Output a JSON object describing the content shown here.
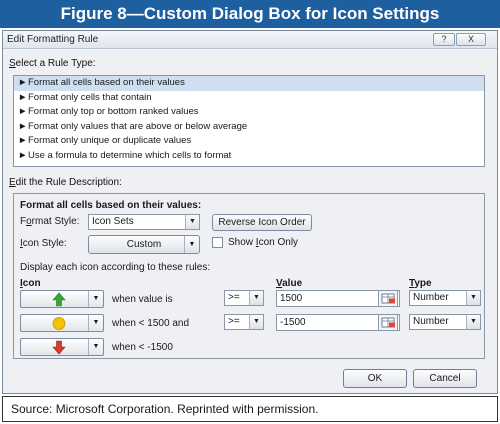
{
  "figure_title": "Figure 8—Custom Dialog Box for Icon Settings",
  "window": {
    "title": "Edit Formatting Rule",
    "help_label": "?",
    "close_label": "X"
  },
  "rule_type": {
    "label_prefix": "",
    "label_u": "S",
    "label_rest": "elect a Rule Type:",
    "bullet": "►",
    "items": [
      "Format all cells based on their values",
      "Format only cells that contain",
      "Format only top or bottom ranked values",
      "Format only values that are above or below average",
      "Format only unique or duplicate values",
      "Use a formula to determine which cells to format"
    ],
    "selected_index": 0
  },
  "description": {
    "label_prefix": "",
    "label_u": "E",
    "label_rest": "dit the Rule Description:",
    "heading": "Format all cells based on their values:",
    "format_style": {
      "label_a": "F",
      "label_u": "o",
      "label_b": "rmat Style:",
      "value": "Icon Sets",
      "dropdown_icon": "chevron-down-icon"
    },
    "reverse_button": "Reverse Icon Order",
    "icon_style": {
      "label_u": "I",
      "label_rest": "con Style:",
      "value": "Custom"
    },
    "show_icon_only": {
      "label_a": "Show ",
      "label_u": "I",
      "label_b": "con Only",
      "checked": false
    },
    "rules_intro": "Display each icon according to these rules:",
    "columns": {
      "icon_u": "I",
      "icon_rest": "con",
      "value_u": "V",
      "value_rest": "alue",
      "type_u": "T",
      "type_rest": "ype"
    },
    "rules": [
      {
        "icon": "green-up-arrow-icon",
        "icon_color": "#3aa636",
        "condition": "when value is",
        "operator": ">=",
        "value": "1500",
        "type": "Number"
      },
      {
        "icon": "yellow-circle-icon",
        "icon_color": "#f2c200",
        "condition": "when < 1500 and",
        "operator": ">=",
        "value": "-1500",
        "type": "Number"
      },
      {
        "icon": "red-down-arrow-icon",
        "icon_color": "#d93a2b",
        "condition": "when < -1500"
      }
    ]
  },
  "buttons": {
    "ok": "OK",
    "cancel": "Cancel"
  },
  "source": "Source:  Microsoft Corporation. Reprinted with permission.",
  "colors": {
    "banner": "#1e5fa0",
    "selection": "#cfdff1"
  }
}
